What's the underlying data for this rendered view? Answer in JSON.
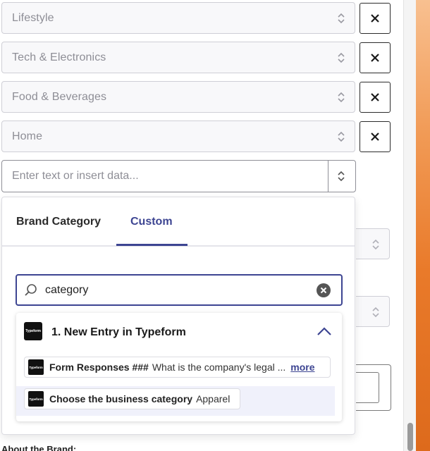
{
  "selects": [
    {
      "value": "Lifestyle"
    },
    {
      "value": "Tech & Electronics"
    },
    {
      "value": "Food & Beverages"
    },
    {
      "value": "Home"
    }
  ],
  "remove_label": "×",
  "input": {
    "placeholder": "Enter text or insert data..."
  },
  "popup": {
    "tabs": [
      {
        "label": "Brand Category",
        "active": false
      },
      {
        "label": "Custom",
        "active": true
      }
    ],
    "search": {
      "value": "category"
    },
    "group": {
      "title": "1. New Entry in Typeform",
      "logo_text": "Typeform"
    },
    "items": [
      {
        "label": "Form Responses ###",
        "value": "What is the company's legal ...",
        "more": "more"
      },
      {
        "label": "Choose the business category",
        "value": "Apparel"
      }
    ]
  },
  "background": {
    "heading": "About the Brand:"
  },
  "colors": {
    "accent": "#3d4592",
    "highlight": "#f0f1fb",
    "wallpaper": "#e97a2a"
  }
}
